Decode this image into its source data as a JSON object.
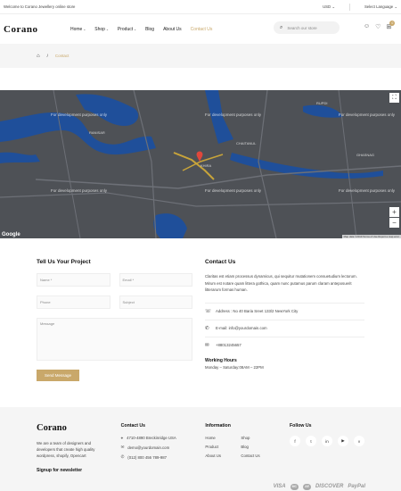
{
  "topbar": {
    "welcome": "Welcome to Corano Jewellery online store",
    "currency": "USD",
    "language": "Select Language"
  },
  "header": {
    "logo": "Corano",
    "nav": [
      {
        "label": "Home",
        "caret": "⌄"
      },
      {
        "label": "Shop",
        "caret": "⌄"
      },
      {
        "label": "Product",
        "caret": "⌄"
      },
      {
        "label": "Blog",
        "caret": ""
      },
      {
        "label": "About Us",
        "caret": ""
      },
      {
        "label": "Contact Us",
        "caret": ""
      }
    ],
    "search_placeholder": "Search our store",
    "cart_count": "0"
  },
  "breadcrumb": {
    "current": "Contact"
  },
  "map": {
    "dev_text": "For development purposes only",
    "places": [
      "RANISAR",
      "CHAITANUL",
      "RUPDI",
      "KHIRA",
      "GHASNAG"
    ],
    "footer": "Map data ©2019   Terms of Use   Report a map error",
    "brand": "Google"
  },
  "form": {
    "title": "Tell Us Your Project",
    "name_placeholder": "Name *",
    "email_placeholder": "Email *",
    "phone_placeholder": "Phone",
    "subject_placeholder": "Subject",
    "message_placeholder": "Message",
    "send_label": "Send Message"
  },
  "contact_info": {
    "title": "Contact Us",
    "description": "Claritas est etiam processus dynamicus, qui sequitur mutationem consuetudium lectorum. Mirum est notare quam littera gothica, quam nunc putamus parum claram anteposuerit litterarum formas humanitatis per seacula quarta decima et quinta decima.",
    "description_shown": "Claritas est etiam processus dynamicus, qui sequitur mutationem consuetudium lectorum. Mirum est notare quam littera gothica, quam nunc putamus parum claram anteposuerit litterarum formas human.",
    "address": "Address : No 40 Baria Sreet 133/2 NewYork City",
    "email": "E-mail: info@yourdomain.com",
    "phone": "+88013245657",
    "hours_title": "Working Hours",
    "hours": "Monday – Saturday:08AM – 22PM"
  },
  "footer": {
    "logo": "Corano",
    "about": "We are a team of designers and developers that create high quality wordpress, shopify, Opencart",
    "signup": "Signup for newsletter",
    "contact_title": "Contact Us",
    "contact_lines": [
      "4710-4890 Breckinridge USA",
      "demo@yourdomain.com",
      "(012) 800 456 789-987"
    ],
    "info_title": "Information",
    "links": [
      "Home",
      "Shop",
      "Product",
      "Blog",
      "About Us",
      "Contact Us"
    ],
    "follow_title": "Follow Us",
    "social": [
      "f",
      "t",
      "in",
      "▶",
      "v"
    ],
    "payments": [
      "VISA",
      "DISCOVER",
      "PayPal"
    ]
  }
}
